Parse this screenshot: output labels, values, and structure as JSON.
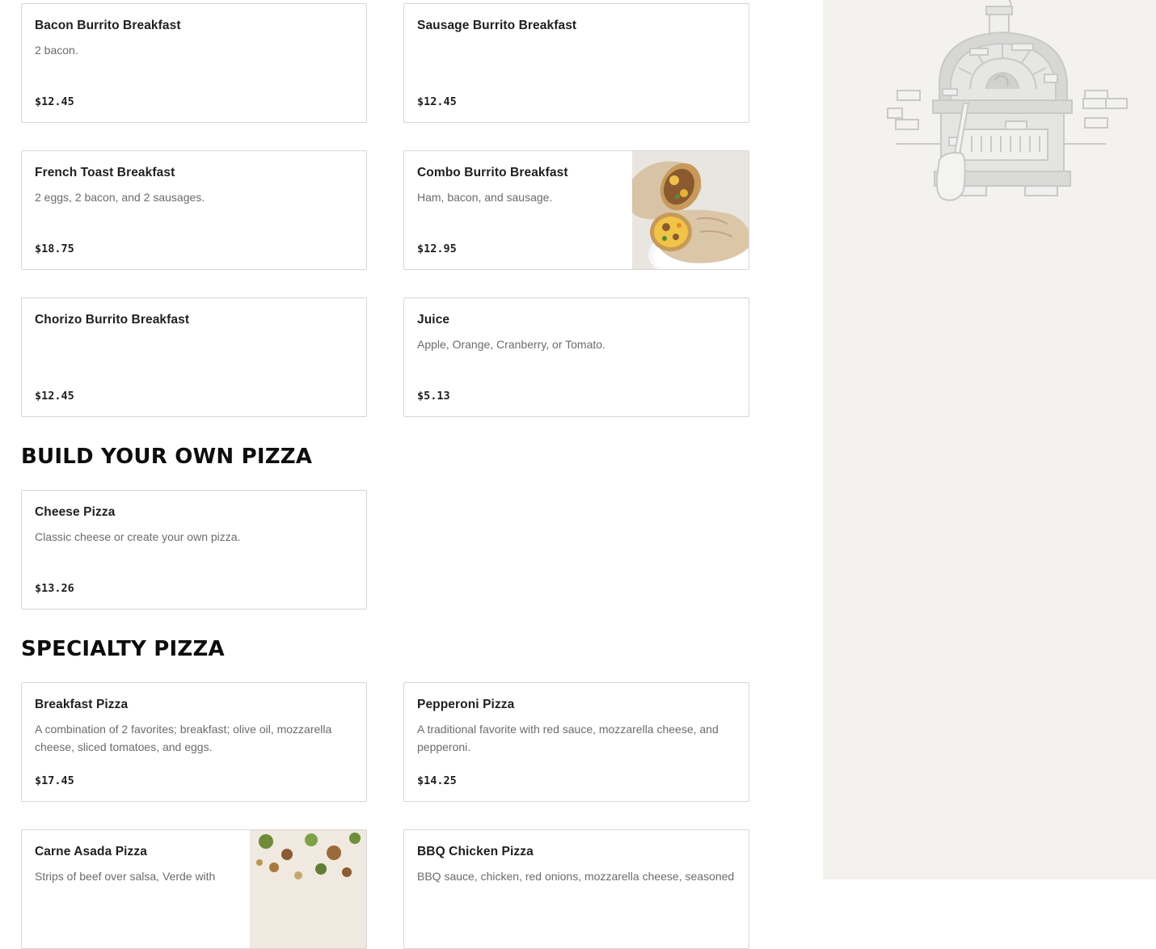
{
  "sections": {
    "build_your_own": {
      "title": "BUILD YOUR OWN PIZZA"
    },
    "specialty": {
      "title": "SPECIALTY PIZZA"
    }
  },
  "items": {
    "bacon_burrito": {
      "name": "Bacon Burrito Breakfast",
      "description": "2 bacon.",
      "price": "$12.45"
    },
    "sausage_burrito": {
      "name": "Sausage Burrito Breakfast",
      "description": "",
      "price": "$12.45"
    },
    "french_toast": {
      "name": "French Toast Breakfast",
      "description": "2 eggs, 2 bacon, and 2 sausages.",
      "price": "$18.75"
    },
    "combo_burrito": {
      "name": "Combo Burrito Breakfast",
      "description": "Ham, bacon, and sausage.",
      "price": "$12.95"
    },
    "chorizo_burrito": {
      "name": "Chorizo Burrito Breakfast",
      "description": "",
      "price": "$12.45"
    },
    "juice": {
      "name": "Juice",
      "description": "Apple, Orange, Cranberry, or Tomato.",
      "price": "$5.13"
    },
    "cheese_pizza": {
      "name": "Cheese Pizza",
      "description": "Classic cheese or create your own pizza.",
      "price": "$13.26"
    },
    "breakfast_pizza": {
      "name": "Breakfast Pizza",
      "description": "A combination of 2 favorites; breakfast; olive oil, mozzarella cheese, sliced tomatoes, and eggs.",
      "price": "$17.45"
    },
    "pepperoni_pizza": {
      "name": "Pepperoni Pizza",
      "description": "A traditional favorite with red sauce, mozzarella cheese, and pepperoni.",
      "price": "$14.25"
    },
    "carne_asada_pizza": {
      "name": "Carne Asada Pizza",
      "description": "Strips of beef over salsa, Verde with",
      "price": ""
    },
    "bbq_chicken_pizza": {
      "name": "BBQ Chicken Pizza",
      "description": "BBQ sauce, chicken, red onions, mozzarella cheese, seasoned",
      "price": ""
    }
  },
  "colors": {
    "sidebar_background": "#f3f2ef",
    "card_border": "#d6d6d6",
    "description_text": "#6b6b6b",
    "illustration_stroke": "#c9c9c9"
  },
  "icons": {
    "sidebar_illustration": "pizza-oven-illustration-icon"
  }
}
